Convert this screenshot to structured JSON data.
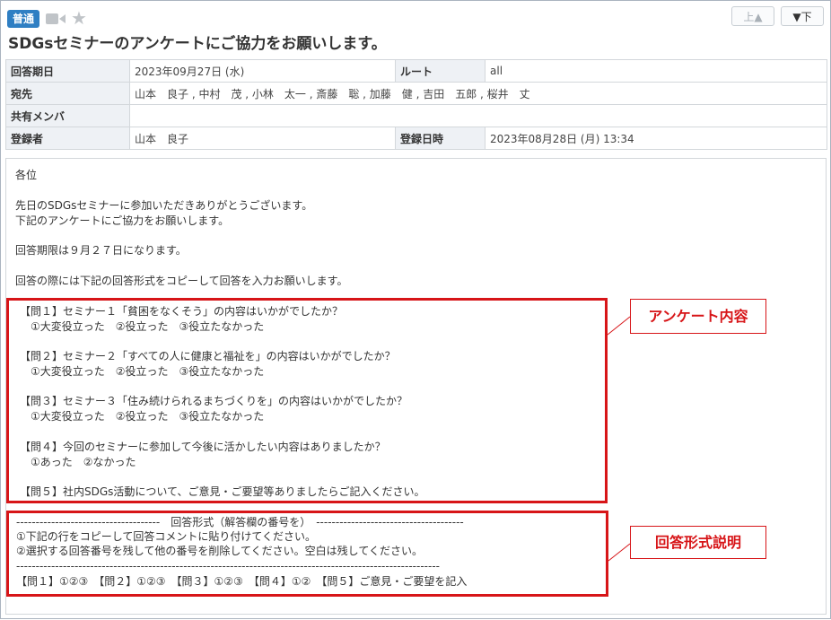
{
  "header": {
    "badge": "普通",
    "nav_up": "上▲",
    "nav_down": "▼下",
    "title": "SDGsセミナーのアンケートにご協力をお願いします。"
  },
  "meta": {
    "answer_deadline_label": "回答期日",
    "answer_deadline_value": "2023年09月27日 (水)",
    "route_label": "ルート",
    "route_value": "all",
    "recipients_label": "宛先",
    "recipients_value": "山本　良子 , 中村　茂 , 小林　太一 , 斎藤　聡 , 加藤　健 , 吉田　五郎 , 桜井　丈",
    "shared_label": "共有メンバ",
    "shared_value": "",
    "registrant_label": "登録者",
    "registrant_value": "山本　良子",
    "registered_label": "登録日時",
    "registered_value": "2023年08月28日 (月) 13:34"
  },
  "body": {
    "greeting": "各位",
    "intro1": "先日のSDGsセミナーに参加いただきありがとうございます。",
    "intro2": "下記のアンケートにご協力をお願いします。",
    "deadline": "回答期限は９月２７日になります。",
    "instruction": "回答の際には下記の回答形式をコピーして回答を入力お願いします。",
    "q1": "【問１】セミナー１「貧困をなくそう」の内容はいかがでしたか？",
    "q1_options": "　①大変役立った　②役立った　③役立たなかった",
    "q2": "【問２】セミナー２「すべての人に健康と福祉を」の内容はいかがでしたか？",
    "q2_options": "　①大変役立った　②役立った　③役立たなかった",
    "q3": "【問３】セミナー３「住み続けられるまちづくりを」の内容はいかがでしたか？",
    "q3_options": "　①大変役立った　②役立った　③役立たなかった",
    "q4": "【問４】今回のセミナーに参加して今後に活かしたい内容はありましたか？",
    "q4_options": "　①あった　②なかった",
    "q5": "【問５】社内SDGs活動について、ご意見・ご要望等ありましたらご記入ください。",
    "format_header": "-------------------------------------　回答形式（解答欄の番号を）　--------------------------------------",
    "format_step1": "①下記の行をコピーして回答コメントに貼り付けてください。",
    "format_step2": "②選択する回答番号を残して他の番号を削除してください。空白は残してください。",
    "format_rule": "-------------------------------------------------------------------------------------------------------------",
    "format_answer": "【問１】①②③　【問２】①②③　【問３】①②③　【問４】①②　【問５】ご意見・ご要望を記入",
    "format_rule2": "-------------------------------------------------------------------------------------------------------------"
  },
  "annotations": {
    "survey_label": "アンケート内容",
    "format_label": "回答形式説明",
    "color": "#d71518"
  }
}
